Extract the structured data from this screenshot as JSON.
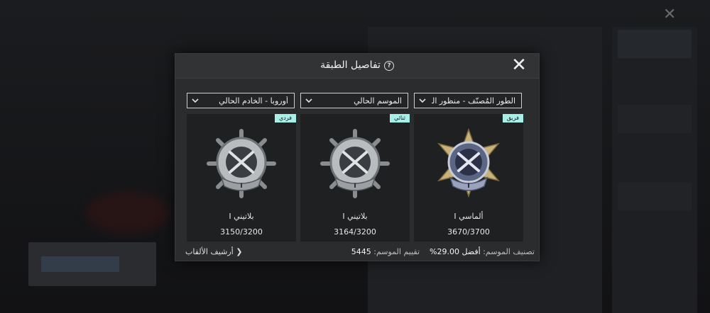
{
  "dialog": {
    "title": "تفاصيل الطبقة",
    "help_icon": "question-circle-icon",
    "close_icon": "close-x-icon"
  },
  "filters": [
    {
      "value": "أوروبا - الخادم الحالي"
    },
    {
      "value": "الموسم الحالي"
    },
    {
      "value": "الطور المُصنّف - منظور الشخص"
    }
  ],
  "cards": [
    {
      "badge": "فردي",
      "tier": "بلاتيني I",
      "points": "3150/3200",
      "emblem": "platinum-rank-icon",
      "emblem_color": "#b9bcbf"
    },
    {
      "badge": "ثنائي",
      "tier": "بلاتيني I",
      "points": "3164/3200",
      "emblem": "platinum-rank-icon",
      "emblem_color": "#b9bcbf"
    },
    {
      "badge": "فريق",
      "tier": "ألماسي I",
      "points": "3670/3700",
      "emblem": "diamond-rank-icon",
      "emblem_color": "#8a95b8"
    }
  ],
  "footer": {
    "archive_label": "أرشيف الألقاب",
    "season_rating_label": "تقييم الموسم:",
    "season_rating_value": "5445",
    "season_rank_label": "تصنيف الموسم:",
    "season_rank_value": "أفضل 29.00%"
  },
  "colors": {
    "badge": "#a7f0e8",
    "dialog_bg": "#2b2c2e",
    "card_bg": "#1f2022"
  }
}
